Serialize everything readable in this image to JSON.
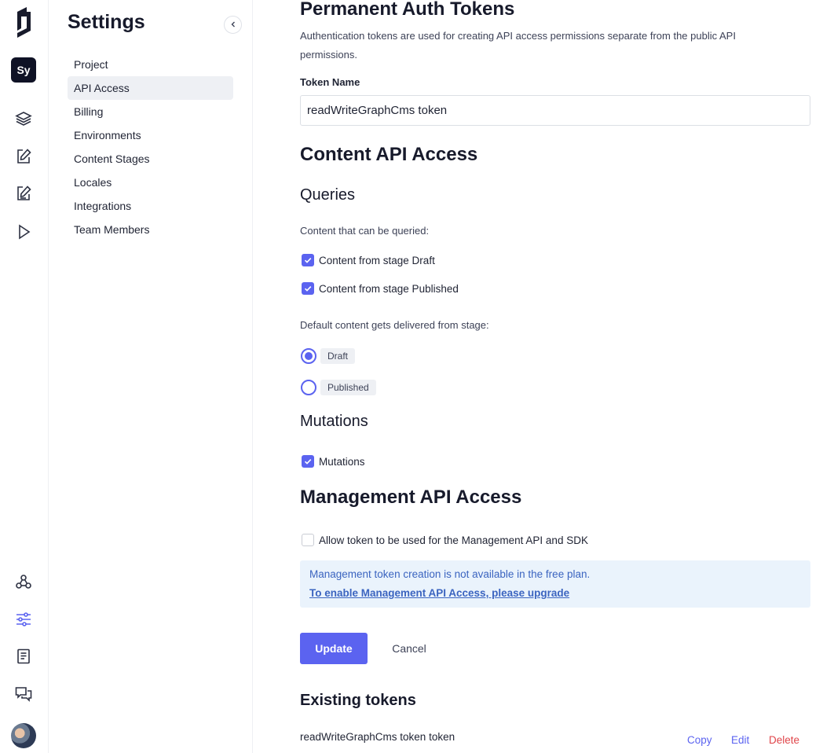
{
  "rail": {
    "project_initials": "Sy",
    "icons": [
      "logo-icon",
      "schema-layers-icon",
      "content-edit-icon",
      "content-edit-alt-icon",
      "playground-icon",
      "webhooks-icon",
      "settings-sliders-icon",
      "docs-book-icon",
      "chat-icon"
    ]
  },
  "sidebar": {
    "title": "Settings",
    "items": [
      {
        "label": "Project"
      },
      {
        "label": "API Access"
      },
      {
        "label": "Billing"
      },
      {
        "label": "Environments"
      },
      {
        "label": "Content Stages"
      },
      {
        "label": "Locales"
      },
      {
        "label": "Integrations"
      },
      {
        "label": "Team Members"
      }
    ],
    "active": "API Access"
  },
  "main": {
    "title": "Permanent Auth Tokens",
    "description": "Authentication tokens are used for creating API access permissions separate from the public API permissions.",
    "token_name_label": "Token Name",
    "token_name_value": "readWriteGraphCms token",
    "content_api": {
      "title": "Content API Access",
      "queries_title": "Queries",
      "queries_label": "Content that can be queried:",
      "stage_checks": [
        {
          "label": "Content from stage Draft",
          "checked": true
        },
        {
          "label": "Content from stage Published",
          "checked": true
        }
      ],
      "default_label": "Default content gets delivered from stage:",
      "stages": [
        {
          "label": "Draft",
          "selected": true
        },
        {
          "label": "Published",
          "selected": false
        }
      ],
      "mutations_title": "Mutations",
      "mutations_check": {
        "label": "Mutations",
        "checked": true
      }
    },
    "management_api": {
      "title": "Management API Access",
      "allow_check": {
        "label": "Allow token to be used for the Management API and SDK",
        "checked": false
      },
      "notice_text": "Management token creation is not available in the free plan.",
      "notice_link": "To enable Management API Access, please upgrade"
    },
    "buttons": {
      "update": "Update",
      "cancel": "Cancel"
    },
    "existing": {
      "title": "Existing tokens",
      "tokens": [
        {
          "name": "readWriteGraphCms token token",
          "copy": "Copy",
          "edit": "Edit",
          "delete": "Delete"
        }
      ]
    }
  },
  "colors": {
    "accent": "#5b63f0",
    "danger": "#e0454a",
    "notice_bg": "#eaf3fc",
    "notice_text": "#3b64c0"
  }
}
